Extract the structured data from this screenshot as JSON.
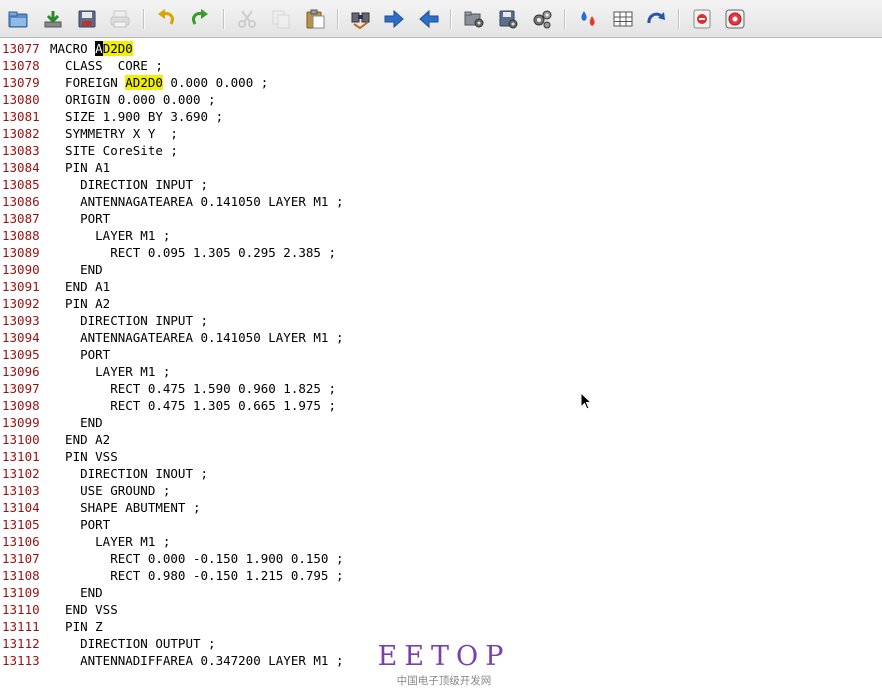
{
  "toolbar": {
    "buttons": [
      {
        "name": "open-folder-icon",
        "disabled": false
      },
      {
        "name": "download-icon",
        "disabled": false
      },
      {
        "name": "save-icon",
        "disabled": false
      },
      {
        "name": "print-icon",
        "disabled": true
      },
      {
        "name": "undo-icon",
        "disabled": false
      },
      {
        "name": "redo-icon",
        "disabled": false
      },
      {
        "name": "cut-icon",
        "disabled": true
      },
      {
        "name": "copy-icon",
        "disabled": true
      },
      {
        "name": "paste-icon",
        "disabled": false
      },
      {
        "name": "find-icon",
        "disabled": false
      },
      {
        "name": "forward-arrow-icon",
        "disabled": false
      },
      {
        "name": "back-arrow-icon",
        "disabled": false
      },
      {
        "name": "folder-settings-icon",
        "disabled": false
      },
      {
        "name": "save-settings-icon",
        "disabled": false
      },
      {
        "name": "gears-icon",
        "disabled": false
      },
      {
        "name": "color-drop-icon",
        "disabled": false
      },
      {
        "name": "table-icon",
        "disabled": false
      },
      {
        "name": "rotate-icon",
        "disabled": false
      },
      {
        "name": "stop-icon",
        "disabled": false
      },
      {
        "name": "help-icon",
        "disabled": false
      }
    ]
  },
  "editor": {
    "highlight_word": "AD2D0",
    "cursor_line": "13077",
    "lines": [
      {
        "num": "13077",
        "text": "MACRO AD2D0"
      },
      {
        "num": "13078",
        "text": "  CLASS  CORE ;"
      },
      {
        "num": "13079",
        "text": "  FOREIGN AD2D0 0.000 0.000 ;"
      },
      {
        "num": "13080",
        "text": "  ORIGIN 0.000 0.000 ;"
      },
      {
        "num": "13081",
        "text": "  SIZE 1.900 BY 3.690 ;"
      },
      {
        "num": "13082",
        "text": "  SYMMETRY X Y  ;"
      },
      {
        "num": "13083",
        "text": "  SITE CoreSite ;"
      },
      {
        "num": "13084",
        "text": "  PIN A1"
      },
      {
        "num": "13085",
        "text": "    DIRECTION INPUT ;"
      },
      {
        "num": "13086",
        "text": "    ANTENNAGATEAREA 0.141050 LAYER M1 ;"
      },
      {
        "num": "13087",
        "text": "    PORT"
      },
      {
        "num": "13088",
        "text": "      LAYER M1 ;"
      },
      {
        "num": "13089",
        "text": "        RECT 0.095 1.305 0.295 2.385 ;"
      },
      {
        "num": "13090",
        "text": "    END"
      },
      {
        "num": "13091",
        "text": "  END A1"
      },
      {
        "num": "13092",
        "text": "  PIN A2"
      },
      {
        "num": "13093",
        "text": "    DIRECTION INPUT ;"
      },
      {
        "num": "13094",
        "text": "    ANTENNAGATEAREA 0.141050 LAYER M1 ;"
      },
      {
        "num": "13095",
        "text": "    PORT"
      },
      {
        "num": "13096",
        "text": "      LAYER M1 ;"
      },
      {
        "num": "13097",
        "text": "        RECT 0.475 1.590 0.960 1.825 ;"
      },
      {
        "num": "13098",
        "text": "        RECT 0.475 1.305 0.665 1.975 ;"
      },
      {
        "num": "13099",
        "text": "    END"
      },
      {
        "num": "13100",
        "text": "  END A2"
      },
      {
        "num": "13101",
        "text": "  PIN VSS"
      },
      {
        "num": "13102",
        "text": "    DIRECTION INOUT ;"
      },
      {
        "num": "13103",
        "text": "    USE GROUND ;"
      },
      {
        "num": "13104",
        "text": "    SHAPE ABUTMENT ;"
      },
      {
        "num": "13105",
        "text": "    PORT"
      },
      {
        "num": "13106",
        "text": "      LAYER M1 ;"
      },
      {
        "num": "13107",
        "text": "        RECT 0.000 -0.150 1.900 0.150 ;"
      },
      {
        "num": "13108",
        "text": "        RECT 0.980 -0.150 1.215 0.795 ;"
      },
      {
        "num": "13109",
        "text": "    END"
      },
      {
        "num": "13110",
        "text": "  END VSS"
      },
      {
        "num": "13111",
        "text": "  PIN Z"
      },
      {
        "num": "13112",
        "text": "    DIRECTION OUTPUT ;"
      },
      {
        "num": "13113",
        "text": "    ANTENNADIFFAREA 0.347200 LAYER M1 ;"
      }
    ]
  },
  "watermark": {
    "logo": "EETOP",
    "tagline": "中国电子顶级开发网"
  },
  "colors": {
    "line_number": "#9a1010",
    "highlight": "#f0f000",
    "watermark": "#7a3fb0"
  }
}
